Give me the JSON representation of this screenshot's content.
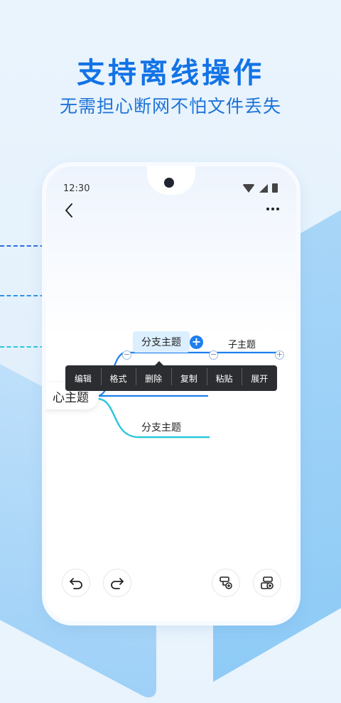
{
  "promo": {
    "headline": "支持离线操作",
    "subline": "无需担心断网不怕文件丢失"
  },
  "status_bar": {
    "time": "12:30"
  },
  "mindmap": {
    "root_label": "心主题",
    "branch_selected_label": "分支主题",
    "subtopic_label": "子主题",
    "branch_second_label": "分支主题",
    "plus_label": "+"
  },
  "context_menu": {
    "items": [
      "编辑",
      "格式",
      "删除",
      "复制",
      "粘贴",
      "展开"
    ]
  },
  "colors": {
    "headline": "#1273e6",
    "line_blue": "#1e7ff0",
    "line_cyan": "#2cc6dc",
    "menu_bg": "#2b2d30"
  },
  "icons": {
    "back": "back-chevron-icon",
    "more": "more-dots-icon",
    "undo": "undo-icon",
    "redo": "redo-icon",
    "add_subtopic": "add-subtopic-icon",
    "add_topic": "add-topic-icon"
  }
}
